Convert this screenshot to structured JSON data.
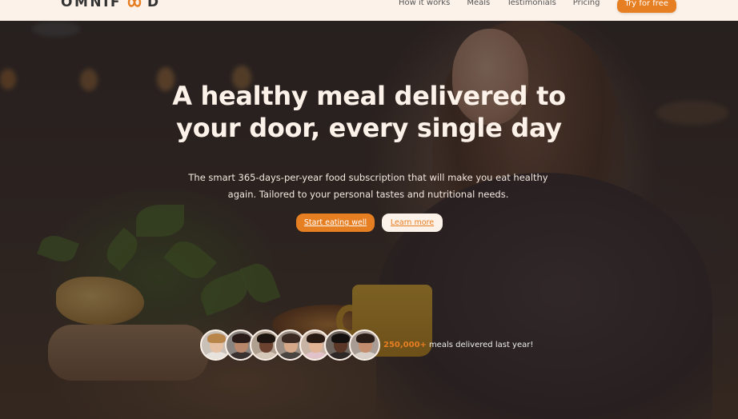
{
  "brand": {
    "logo_text_left": "OMNIF",
    "logo_text_right": "D"
  },
  "nav": {
    "items": [
      "How it works",
      "Meals",
      "Testimonials",
      "Pricing"
    ],
    "cta": "Try for free"
  },
  "hero": {
    "title_line1": "A healthy meal delivered to",
    "title_line2": "your door, every single day",
    "subtitle_line1": "The smart 365-days-per-year food subscription that will make you eat healthy",
    "subtitle_line2": "again. Tailored to your personal tastes and nutritional needs.",
    "primary_button": "Start eating well",
    "secondary_button": "Learn more"
  },
  "customers": {
    "count": "250,000+",
    "text": "meals delivered last year!"
  },
  "colors": {
    "accent": "#e67e22",
    "header_bg": "#fdf2e9",
    "text_dark": "#333333"
  }
}
